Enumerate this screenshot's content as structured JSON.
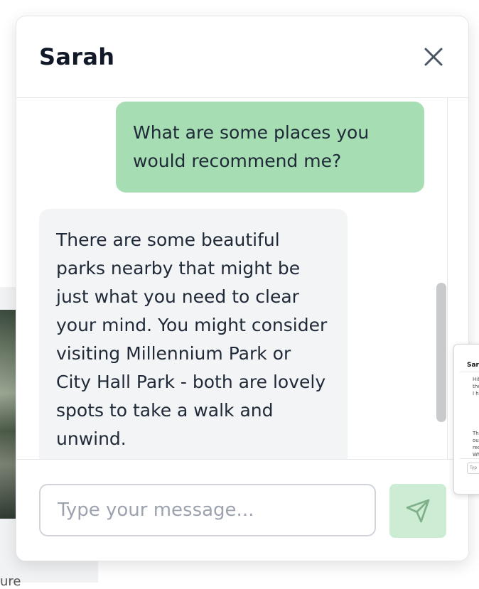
{
  "chat": {
    "title": "Sarah",
    "messages": [
      {
        "role": "user",
        "text": "What are some places you would recommend me?"
      },
      {
        "role": "assistant",
        "text": "There are some beautiful parks nearby that might be just what you need to clear your mind. You might consider visiting Millennium Park or City Hall Park - both are lovely spots to take a walk and unwind."
      }
    ],
    "input": {
      "value": "",
      "placeholder": "Type your message..."
    }
  },
  "background": {
    "cut_text": "ure"
  },
  "mini_preview": {
    "title": "Sara",
    "text_top": "Hi!\nthe\nI h",
    "text_bottom": "Tha\nout\nrec\nWh",
    "input_placeholder": "Typ"
  },
  "icons": {
    "close": "close-icon",
    "send": "send-icon"
  },
  "colors": {
    "user_bubble": "#a6ddb3",
    "assistant_bubble": "#f3f4f6",
    "send_button": "#cdecd4"
  }
}
